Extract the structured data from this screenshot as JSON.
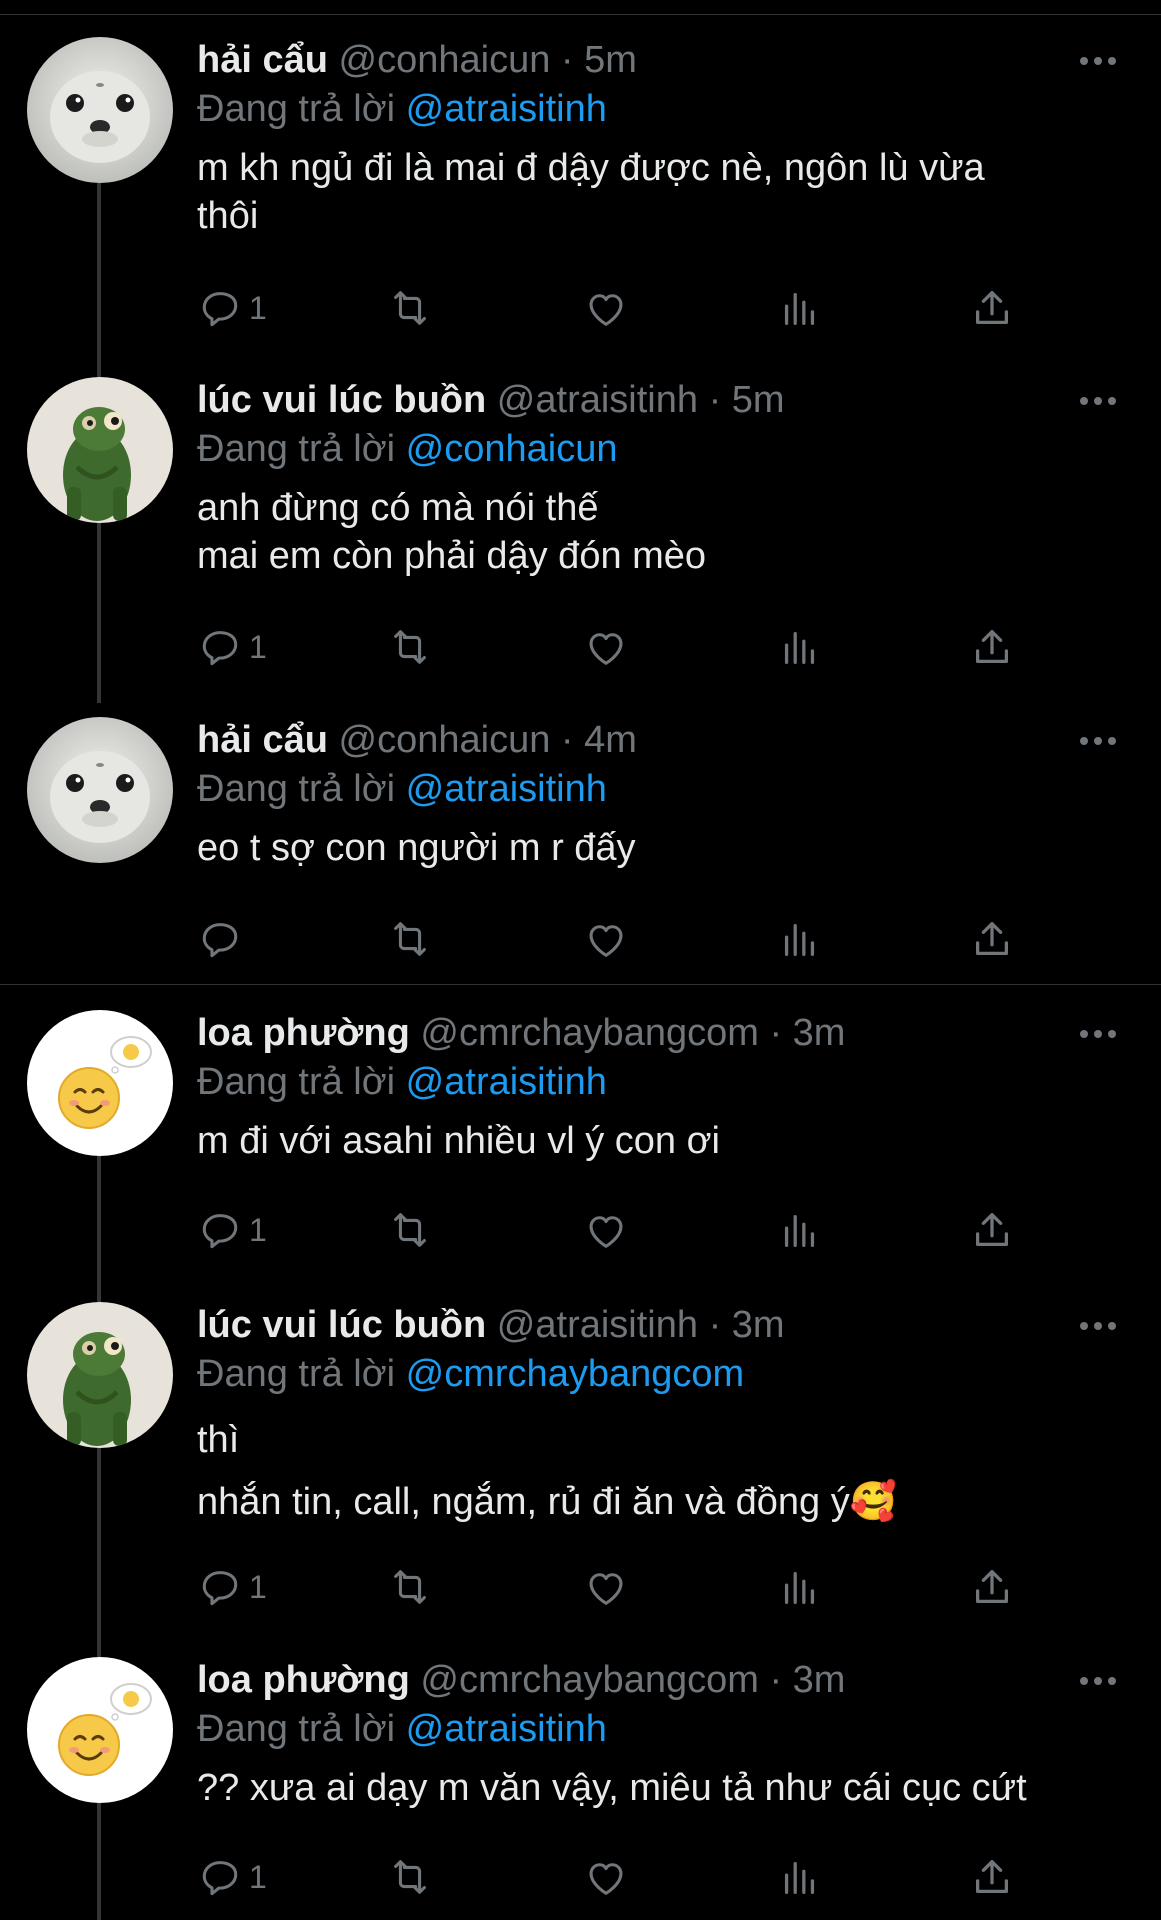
{
  "tweets": [
    {
      "display_name": "hải cẩu",
      "handle": "@conhaicun",
      "time": "5m",
      "replying_prefix": "Đang trả lời",
      "replying_to": "@atraisitinh",
      "text": "m kh ngủ đi là mai đ dậy được nè, ngôn lù vừa\nthôi",
      "reply_count": "1",
      "avatar_icon": "seal-avatar"
    },
    {
      "display_name": "lúc vui lúc buồn",
      "handle": "@atraisitinh",
      "time": "5m",
      "replying_prefix": "Đang trả lời",
      "replying_to": "@conhaicun",
      "text": "anh đừng có mà nói thế\nmai em còn phải dậy đón mèo",
      "reply_count": "1",
      "avatar_icon": "frog-avatar"
    },
    {
      "display_name": "hải cẩu",
      "handle": "@conhaicun",
      "time": "4m",
      "replying_prefix": "Đang trả lời",
      "replying_to": "@atraisitinh",
      "text": "eo t sợ con người m r đấy",
      "reply_count": "",
      "avatar_icon": "seal-avatar"
    },
    {
      "display_name": "loa phường",
      "handle": "@cmrchaybangcom",
      "time": "3m",
      "replying_prefix": "Đang trả lời",
      "replying_to": "@atraisitinh",
      "text": "m đi với asahi nhiều vl ý con ơi",
      "reply_count": "1",
      "avatar_icon": "smiley-avatar"
    },
    {
      "display_name": "lúc vui lúc buồn",
      "handle": "@atraisitinh",
      "time": "3m",
      "replying_prefix": "Đang trả lời",
      "replying_to": "@cmrchaybangcom",
      "text": "thì\nnhắn tin, call, ngắm, rủ đi ăn và đồng ý🥰",
      "reply_count": "1",
      "avatar_icon": "frog-avatar"
    },
    {
      "display_name": "loa phường",
      "handle": "@cmrchaybangcom",
      "time": "3m",
      "replying_prefix": "Đang trả lời",
      "replying_to": "@atraisitinh",
      "text": "?? xưa ai dạy m văn vậy, miêu tả như cái cục cứt",
      "reply_count": "1",
      "avatar_icon": "smiley-avatar"
    }
  ],
  "separator": "·",
  "colors": {
    "background": "#000000",
    "text": "#e7e9ea",
    "muted": "#71767b",
    "mention": "#1d9bf0",
    "divider": "#2f3336"
  },
  "icons": [
    "reply-icon",
    "retweet-icon",
    "like-icon",
    "views-icon",
    "share-icon",
    "more-icon"
  ]
}
